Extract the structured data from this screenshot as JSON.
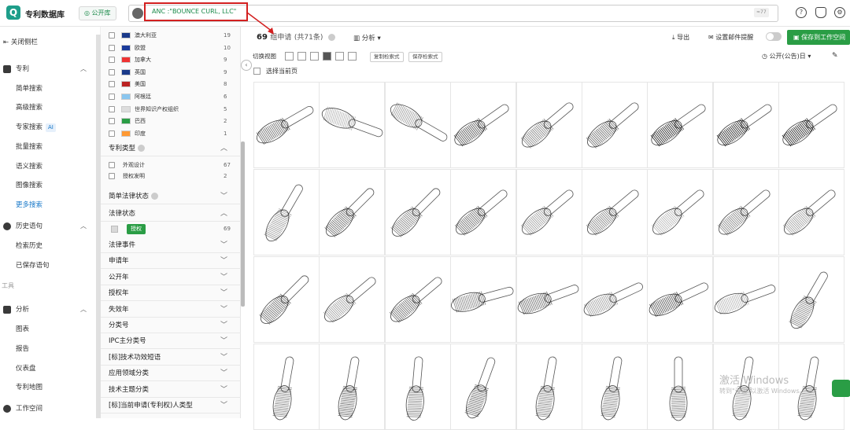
{
  "header": {
    "app_name": "专利数据库",
    "library_label": "公开库",
    "query": "ANC :\"BOUNCE CURL, LLC\"",
    "counter": "≈77"
  },
  "nav": {
    "close_sidebar": "关闭侧栏",
    "patent": "专利",
    "patent_items": [
      "简单搜索",
      "高级搜索",
      "专家搜索",
      "批量搜索",
      "语义搜索",
      "图像搜索",
      "更多搜索"
    ],
    "ai_badge": "AI",
    "history": "历史语句",
    "history_items": [
      "检索历史",
      "已保存语句"
    ],
    "tools_label": "工具",
    "analysis": "分析",
    "analysis_items": [
      "图表",
      "报告",
      "仪表盘",
      "专利地图"
    ],
    "workspace": "工作空间"
  },
  "countries": [
    {
      "name": "澳大利亚",
      "count": "19"
    },
    {
      "name": "欧盟",
      "count": "10"
    },
    {
      "name": "加拿大",
      "count": "9"
    },
    {
      "name": "英国",
      "count": "9"
    },
    {
      "name": "美国",
      "count": "8"
    },
    {
      "name": "阿根廷",
      "count": "6"
    },
    {
      "name": "世界知识产权组织",
      "count": "5"
    },
    {
      "name": "巴西",
      "count": "2"
    },
    {
      "name": "印度",
      "count": "1"
    }
  ],
  "patent_type": {
    "title": "专利类型",
    "items": [
      {
        "name": "外观设计",
        "count": "67"
      },
      {
        "name": "授权发明",
        "count": "2"
      }
    ]
  },
  "filter_sections": {
    "simple_legal": "简单法律状态",
    "legal": "法律状态",
    "legal_item": "授权",
    "legal_count": "69",
    "more": [
      "法律事件",
      "申请年",
      "公开年",
      "授权年",
      "失效年",
      "分类号",
      "IPC主分类号",
      "[标]技术功效短语",
      "应用领域分类",
      "技术主题分类",
      "[标]当前申请(专利权)人类型"
    ]
  },
  "results": {
    "count": "69",
    "unit": "组申请",
    "total": "(共71条)",
    "analysis": "分析",
    "export": "导出",
    "email_alert": "设置邮件提醒",
    "save_workspace": "保存到工作空间",
    "switch_view": "切换视图",
    "copy_style": "复制检索式",
    "save_style": "保存检索式",
    "sort": "公开(公告)日",
    "select_page": "选择当前页"
  },
  "watermark": {
    "line1": "激活 Windows",
    "line2": "转到\"设置\"以激活 Windows。"
  }
}
